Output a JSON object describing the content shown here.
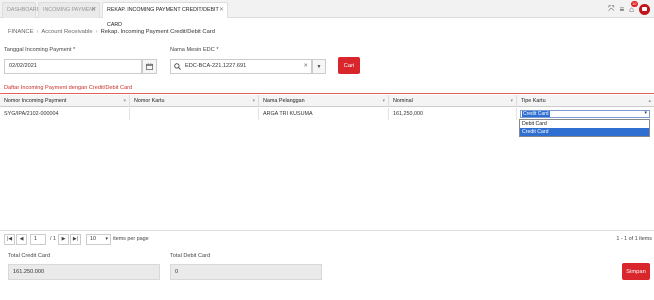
{
  "tabs": [
    {
      "label": "DASHBOARD"
    },
    {
      "label": "INCOMING PAYMENT"
    },
    {
      "label": "REKAP. INCOMING PAYMENT CREDIT/DEBIT CARD"
    }
  ],
  "toolbar": {
    "notification_count": "10"
  },
  "breadcrumb": [
    "FINANCE",
    "Account Receivable",
    "Rekap. Incoming Payment Credit/Debit Card"
  ],
  "form": {
    "date_label": "Tanggal Incoming Payment *",
    "date_value": "02/02/2021",
    "edc_label": "Nama Mesin EDC *",
    "edc_value": "EDC-BCA-221.1227.691",
    "search_button": "Cari"
  },
  "section_title": "Daftar Incoming Payment dengan Credit/Debit Card",
  "grid": {
    "columns": [
      "Nomor Incoming Payment",
      "Nomor Kartu",
      "Nama Pelanggan",
      "Nominal",
      "Tipe Kartu"
    ],
    "rows": [
      {
        "nomor": "SYG/IPA/2102-000004",
        "kartu": "",
        "pelanggan": "ARGA TRI KUSUMA",
        "nominal": "161,250,000",
        "tipe": "Credit Card"
      }
    ]
  },
  "tipe_kartu_options": [
    "Debit Card",
    "Credit Card"
  ],
  "pager": {
    "page": "1",
    "of_text": "/ 1",
    "page_size": "10",
    "per_page_label": "items per page",
    "info": "1 - 1 of 1 items"
  },
  "totals": {
    "credit_label": "Total Credit Card",
    "credit_value": "161.250.000",
    "debit_label": "Total Debit Card",
    "debit_value": "0",
    "save_button": "Simpan"
  }
}
